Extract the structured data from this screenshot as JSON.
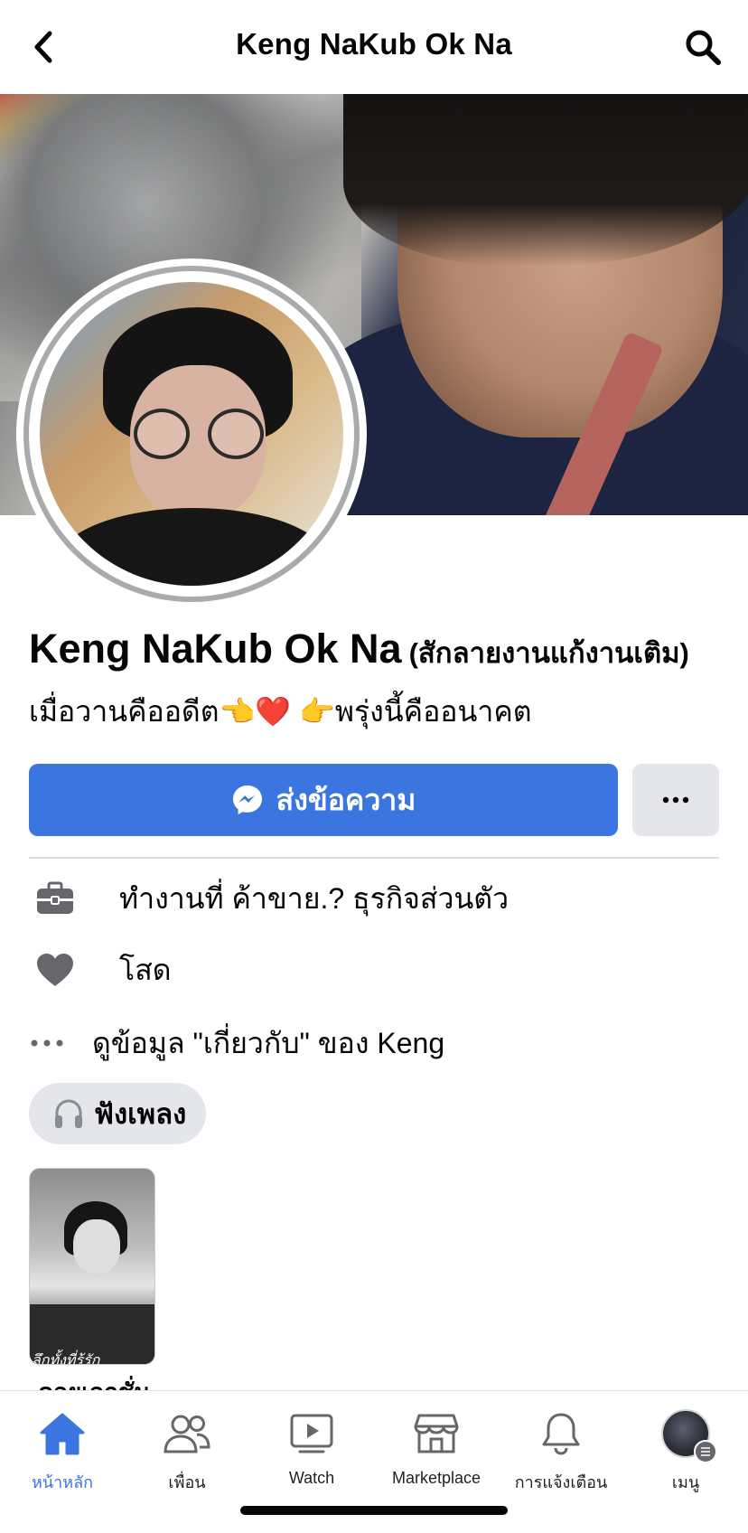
{
  "header": {
    "title": "Keng NaKub Ok Na",
    "back_icon": "chevron-left-icon",
    "search_icon": "search-icon"
  },
  "profile": {
    "name": "Keng NaKub Ok Na",
    "alt_name": "(สักลายงานแก้งานเติม)",
    "bio": "เมื่อวานคืออดีต👈❤️ 👉พรุ่งนี้คืออนาคต"
  },
  "actions": {
    "message_label": "ส่งข้อความ",
    "message_icon": "messenger-icon",
    "more_icon": "more-horizontal-icon"
  },
  "info": [
    {
      "icon": "briefcase-icon",
      "text": "ทำงานที่ ค้าขาย.? ธุรกิจส่วนตัว"
    },
    {
      "icon": "heart-icon",
      "text": "โสด"
    },
    {
      "icon": "more-horizontal-icon",
      "text": "ดูข้อมูล \"เกี่ยวกับ\" ของ Keng"
    }
  ],
  "music_chip": {
    "label": "ฟังเพลง",
    "icon": "headphones-icon"
  },
  "story": {
    "overlay_text": "ลึกทั้งที่รู้รัก",
    "caption": "คอยเลกชั่น"
  },
  "tabs": [
    {
      "label": "หน้าหลัก",
      "icon": "home-icon",
      "active": true
    },
    {
      "label": "เพื่อน",
      "icon": "friends-icon",
      "active": false
    },
    {
      "label": "Watch",
      "icon": "watch-icon",
      "active": false
    },
    {
      "label": "Marketplace",
      "icon": "marketplace-icon",
      "active": false
    },
    {
      "label": "การแจ้งเตือน",
      "icon": "bell-icon",
      "active": false
    },
    {
      "label": "เมนู",
      "icon": "menu-avatar-icon",
      "active": false
    }
  ],
  "colors": {
    "accent": "#3A75E0",
    "secondary_button": "#E4E6EB",
    "icon_gray": "#65676B"
  }
}
